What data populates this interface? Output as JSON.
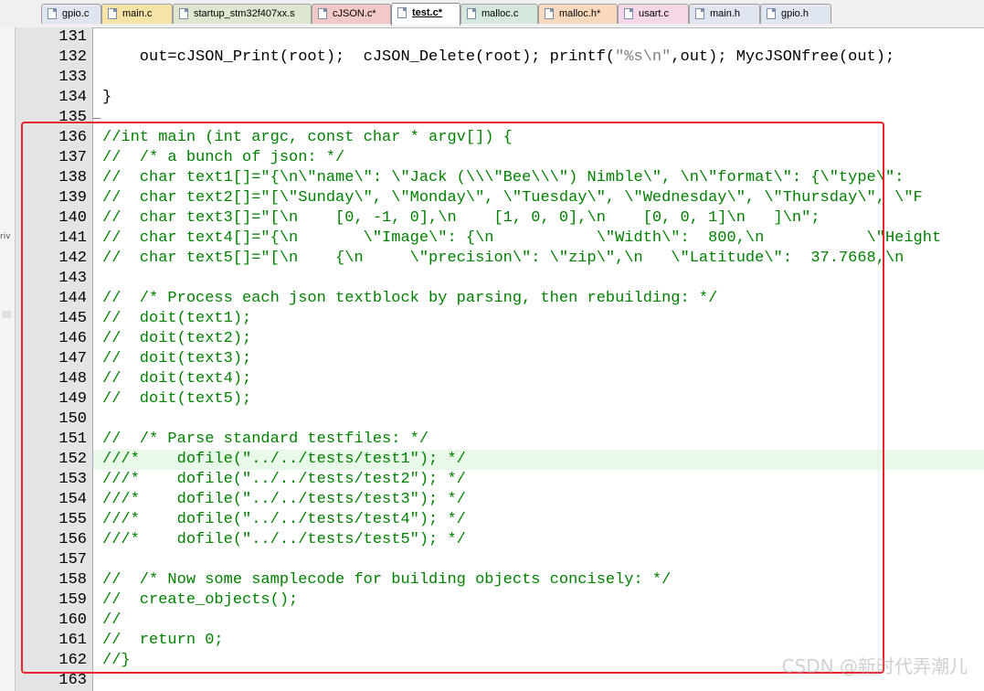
{
  "tabs": [
    {
      "label": "gpio.c",
      "color": "#dfe6ef"
    },
    {
      "label": "main.c",
      "color": "#f6e3a6"
    },
    {
      "label": "startup_stm32f407xx.s",
      "color": "#dde7cf"
    },
    {
      "label": "cJSON.c*",
      "color": "#f2c9c6"
    },
    {
      "label": "test.c*",
      "color": "#ffffff"
    },
    {
      "label": "malloc.c",
      "color": "#d4e9dc"
    },
    {
      "label": "malloc.h*",
      "color": "#f8d9be"
    },
    {
      "label": "usart.c",
      "color": "#f5d7e7"
    },
    {
      "label": "main.h",
      "color": "#dfe6ef"
    },
    {
      "label": "gpio.h",
      "color": "#dfe6ef"
    }
  ],
  "left_fragment": "riv",
  "lines": [
    {
      "num": "131",
      "text": "",
      "kind": "plain"
    },
    {
      "num": "132",
      "text": "    out=cJSON_Print(root);  cJSON_Delete(root); printf(\"%s\\n\",out); MycJSONfree(out);",
      "kind": "printf"
    },
    {
      "num": "133",
      "text": "",
      "kind": "plain"
    },
    {
      "num": "134",
      "text": "}",
      "kind": "plain"
    },
    {
      "num": "135",
      "text": "",
      "kind": "plain"
    },
    {
      "num": "136",
      "text": "//int main (int argc, const char * argv[]) {",
      "kind": "comment"
    },
    {
      "num": "137",
      "text": "//  /* a bunch of json: */",
      "kind": "comment"
    },
    {
      "num": "138",
      "text": "//  char text1[]=\"{\\n\\\"name\\\": \\\"Jack (\\\\\\\"Bee\\\\\\\") Nimble\\\", \\n\\\"format\\\": {\\\"type\\\":",
      "kind": "comment"
    },
    {
      "num": "139",
      "text": "//  char text2[]=\"[\\\"Sunday\\\", \\\"Monday\\\", \\\"Tuesday\\\", \\\"Wednesday\\\", \\\"Thursday\\\", \\\"F",
      "kind": "comment"
    },
    {
      "num": "140",
      "text": "//  char text3[]=\"[\\n    [0, -1, 0],\\n    [1, 0, 0],\\n    [0, 0, 1]\\n   ]\\n\";",
      "kind": "comment"
    },
    {
      "num": "141",
      "text": "//  char text4[]=\"{\\n       \\\"Image\\\": {\\n           \\\"Width\\\":  800,\\n           \\\"Height",
      "kind": "comment"
    },
    {
      "num": "142",
      "text": "//  char text5[]=\"[\\n    {\\n     \\\"precision\\\": \\\"zip\\\",\\n   \\\"Latitude\\\":  37.7668,\\n",
      "kind": "comment"
    },
    {
      "num": "143",
      "text": "",
      "kind": "plain"
    },
    {
      "num": "144",
      "text": "//  /* Process each json textblock by parsing, then rebuilding: */",
      "kind": "comment"
    },
    {
      "num": "145",
      "text": "//  doit(text1);",
      "kind": "comment"
    },
    {
      "num": "146",
      "text": "//  doit(text2);",
      "kind": "comment"
    },
    {
      "num": "147",
      "text": "//  doit(text3);",
      "kind": "comment"
    },
    {
      "num": "148",
      "text": "//  doit(text4);",
      "kind": "comment"
    },
    {
      "num": "149",
      "text": "//  doit(text5);",
      "kind": "comment"
    },
    {
      "num": "150",
      "text": "",
      "kind": "plain"
    },
    {
      "num": "151",
      "text": "//  /* Parse standard testfiles: */",
      "kind": "comment"
    },
    {
      "num": "152",
      "text": "///*    dofile(\"../../tests/test1\"); */",
      "kind": "comment"
    },
    {
      "num": "153",
      "text": "///*    dofile(\"../../tests/test2\"); */",
      "kind": "comment"
    },
    {
      "num": "154",
      "text": "///*    dofile(\"../../tests/test3\"); */",
      "kind": "comment"
    },
    {
      "num": "155",
      "text": "///*    dofile(\"../../tests/test4\"); */",
      "kind": "comment"
    },
    {
      "num": "156",
      "text": "///*    dofile(\"../../tests/test5\"); */",
      "kind": "comment"
    },
    {
      "num": "157",
      "text": "",
      "kind": "plain"
    },
    {
      "num": "158",
      "text": "//  /* Now some samplecode for building objects concisely: */",
      "kind": "comment"
    },
    {
      "num": "159",
      "text": "//  create_objects();",
      "kind": "comment"
    },
    {
      "num": "160",
      "text": "//",
      "kind": "comment"
    },
    {
      "num": "161",
      "text": "//  return 0;",
      "kind": "comment"
    },
    {
      "num": "162",
      "text": "//}",
      "kind": "comment"
    },
    {
      "num": "163",
      "text": "",
      "kind": "plain"
    }
  ],
  "current_line": "152",
  "highlight_color": "#e8f9ea",
  "annotation_color": "#e8252a",
  "watermark": "CSDN @新时代弄潮儿"
}
